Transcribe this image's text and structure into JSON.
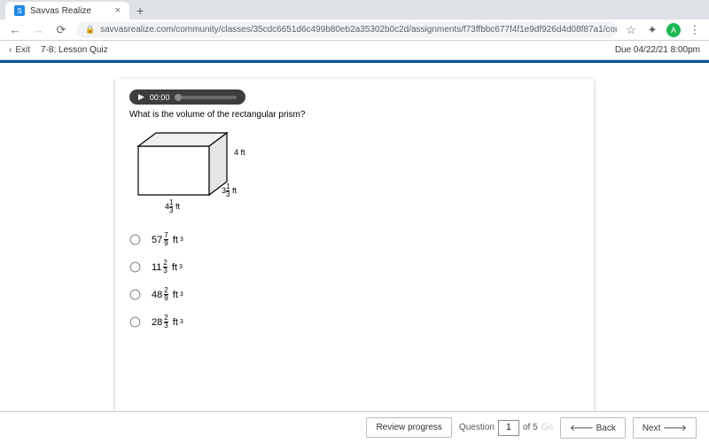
{
  "browser": {
    "tab_title": "Savvas Realize",
    "url": "savvasrealize.com/community/classes/35cdc6651d6c499b80eb2a35302b0c2d/assignments/f73ffbbc677f4f1e9df926d4d08f87a1/content/904d935a-c211-3920-9bda-de...",
    "avatar_letter": "A"
  },
  "topbar": {
    "exit_label": "Exit",
    "lesson_title": "7-8: Lesson Quiz",
    "due_text": "Due 04/22/21 8:00pm"
  },
  "audio": {
    "time": "00:00"
  },
  "question": {
    "prompt": "What is the volume of the rectangular prism?"
  },
  "dimensions": {
    "height": "4 ft",
    "depth_whole": "3",
    "depth_num": "1",
    "depth_den": "3",
    "depth_unit": "ft",
    "width_whole": "4",
    "width_num": "1",
    "width_den": "3",
    "width_unit": "ft"
  },
  "choices": {
    "a_whole": "57",
    "a_num": "7",
    "a_den": "9",
    "a_unit": "ft³",
    "b_whole": "11",
    "b_num": "2",
    "b_den": "3",
    "b_unit": "ft³",
    "c_whole": "48",
    "c_num": "2",
    "c_den": "9",
    "c_unit": "ft³",
    "d_whole": "28",
    "d_num": "2",
    "d_den": "3",
    "d_unit": "ft³"
  },
  "bottom": {
    "review": "Review progress",
    "question_label": "Question",
    "question_num": "1",
    "question_total": "of 5",
    "go": "Go",
    "back": "Back",
    "next": "Next"
  }
}
